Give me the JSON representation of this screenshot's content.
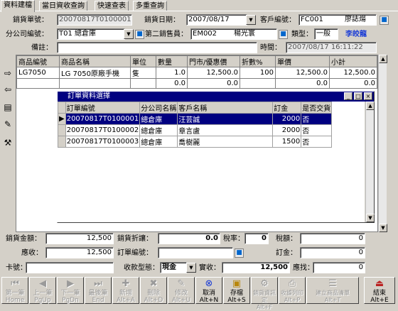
{
  "tabs": [
    "資料建檔",
    "當日資收查詢",
    "快速查表",
    "多重查詢"
  ],
  "header": {
    "order_no_label": "銷貨單號：",
    "order_no": "20070817T0100001",
    "date_label": "銷貨日期：",
    "date": "2007/08/17",
    "customer_label": "客戶編號：",
    "customer_code": "FC001",
    "customer_name": "廖誌煬",
    "branch_label": "分公司編號：",
    "branch": "T01 總倉庫",
    "seller2_label": "第二銷售員：",
    "seller2_code": "EM002",
    "seller2_name": "楊光寰",
    "type_label": "類型：",
    "type": "一般",
    "person": "李皎龍",
    "note_label": "備註：",
    "note": "",
    "time_label": "時間：",
    "time": "2007/08/17 16:11:22"
  },
  "items_table": {
    "headers": [
      "商品編號",
      "商品名稱",
      "單位",
      "數量",
      "門市/優惠價",
      "折數%",
      "單價",
      "小計"
    ],
    "rows": [
      [
        "LG7050",
        "LG 7050原廠手機",
        "隻",
        "1.0",
        "12,500.0",
        "100",
        "12,500.0",
        "12,500.0"
      ],
      [
        "",
        "",
        "",
        "0.0",
        "0.0",
        "",
        "0.0",
        "0.0"
      ]
    ]
  },
  "dialog": {
    "title": "訂單資料選擇",
    "headers": [
      "訂單編號",
      "分公司名稱",
      "客戶名稱",
      "訂金",
      "是否交貨"
    ],
    "rows": [
      [
        "20070817T0100001",
        "總倉庫",
        "汪芸誠",
        "2000",
        "否"
      ],
      [
        "20070817T0100002",
        "總倉庫",
        "章言盧",
        "2000",
        "否"
      ],
      [
        "20070817T0100003",
        "總倉庫",
        "喬樹麗",
        "1500",
        "否"
      ]
    ]
  },
  "footer": {
    "sales_amount_label": "銷貨金額：",
    "sales_amount": "12,500",
    "discount_label": "銷貨折讓：",
    "discount": "0.0",
    "tax_rate_label": "稅率：",
    "tax_rate": "0",
    "tax_label": "稅額：",
    "tax": "0",
    "receivable_label": "應收：",
    "receivable": "12,500",
    "order_no_label": "訂單編號：",
    "order_no": "",
    "deposit_label": "訂金：",
    "deposit": "0",
    "card_label": "卡號：",
    "card": "",
    "payment_type_label": "收款型態：",
    "payment_type": "現金",
    "received_label": "實收：",
    "received": "12,500",
    "change_label": "應找：",
    "change": "0"
  },
  "toolbar": [
    {
      "label1": "第一筆",
      "label2": "Home",
      "icon": "first-icon",
      "enabled": false
    },
    {
      "label1": "上一筆",
      "label2": "PgUp",
      "icon": "prev-icon",
      "enabled": false
    },
    {
      "label1": "下一筆",
      "label2": "PgDn",
      "icon": "next-icon",
      "enabled": false
    },
    {
      "label1": "最後筆",
      "label2": "End",
      "icon": "last-icon",
      "enabled": false
    },
    {
      "label1": "新增",
      "label2": "Alt+A",
      "icon": "add-icon",
      "enabled": false
    },
    {
      "label1": "刪除",
      "label2": "Alt+D",
      "icon": "delete-icon",
      "enabled": false
    },
    {
      "label1": "修改",
      "label2": "Alt+U",
      "icon": "edit-icon",
      "enabled": false
    },
    {
      "label1": "取消",
      "label2": "Alt+N",
      "icon": "cancel-icon",
      "enabled": true
    },
    {
      "label1": "存檔",
      "label2": "Alt+S",
      "icon": "save-icon",
      "enabled": true
    },
    {
      "label1": "銷貨資訊定",
      "label2": "Alt+F",
      "icon": "settings-icon",
      "enabled": false
    },
    {
      "label1": "收據列印",
      "label2": "Alt+P",
      "icon": "print-icon",
      "enabled": false
    },
    {
      "label1": "建立商品清單",
      "label2": "Alt+T",
      "icon": "list-icon",
      "enabled": false
    },
    {
      "label1": "結束",
      "label2": "Alt+E",
      "icon": "exit-icon",
      "enabled": true
    }
  ]
}
